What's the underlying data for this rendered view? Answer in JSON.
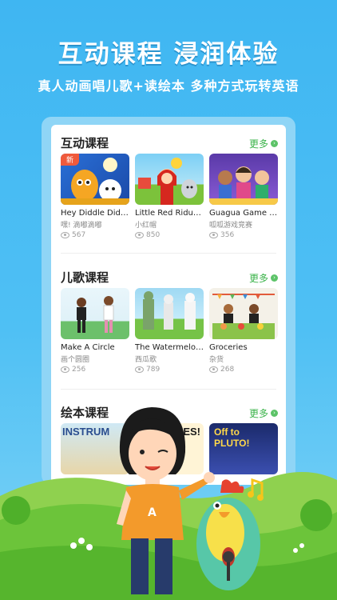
{
  "hero": {
    "title": "互动课程  浸润体验",
    "subtitle": "真人动画唱儿歌+读绘本  多种方式玩转英语"
  },
  "more_label": "更多",
  "sections": [
    {
      "title": "互动课程",
      "items": [
        {
          "name": "Hey Diddle Diddle",
          "sub": "嘿! 滴嘟滴嘟",
          "views": "567",
          "badge": "新"
        },
        {
          "name": "Little Red Ridun...",
          "sub": "小红帽",
          "views": "850"
        },
        {
          "name": "Guagua Game S...",
          "sub": "呱呱游戏竞赛",
          "views": "356"
        }
      ]
    },
    {
      "title": "儿歌课程",
      "items": [
        {
          "name": "Make A Circle",
          "sub": "画个圆圈",
          "views": "256"
        },
        {
          "name": "The Watermelon...",
          "sub": "西瓜歌",
          "views": "789"
        },
        {
          "name": "Groceries",
          "sub": "杂货",
          "views": "268"
        }
      ]
    },
    {
      "title": "绘本课程",
      "items": [
        {
          "thumb_text": "INSTRUM"
        },
        {
          "thumb_text": "LES!"
        },
        {
          "thumb_text": "Off to PLUTO!"
        }
      ]
    }
  ],
  "mascot": {
    "shirt_letter": "A"
  },
  "colors": {
    "sky": "#3fb6f2",
    "grass": "#5cc02e",
    "accent": "#3bb34a",
    "badge": "#f05a3c"
  }
}
